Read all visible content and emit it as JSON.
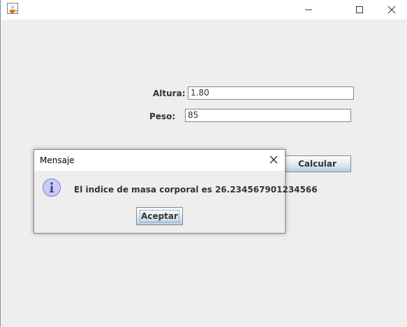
{
  "window": {
    "app_icon": "java-cup-icon",
    "minimize_icon": "minimize-icon",
    "maximize_icon": "maximize-icon",
    "close_icon": "close-icon"
  },
  "form": {
    "altura_label": "Altura:",
    "altura_value": "1.80",
    "peso_label": "Peso:",
    "peso_value": "85",
    "calcular_label": "Calcular"
  },
  "dialog": {
    "title": "Mensaje",
    "message": "El indice de masa corporal es 26.234567901234566",
    "accept_label": "Aceptar",
    "icon": "information-icon"
  },
  "colors": {
    "window_background": "#eeeeee",
    "title_background": "#ffffff",
    "button_gradient_top": "#ffffff",
    "button_gradient_bottom": "#b8cfe5",
    "info_icon_fill": "#c8ccf4"
  }
}
